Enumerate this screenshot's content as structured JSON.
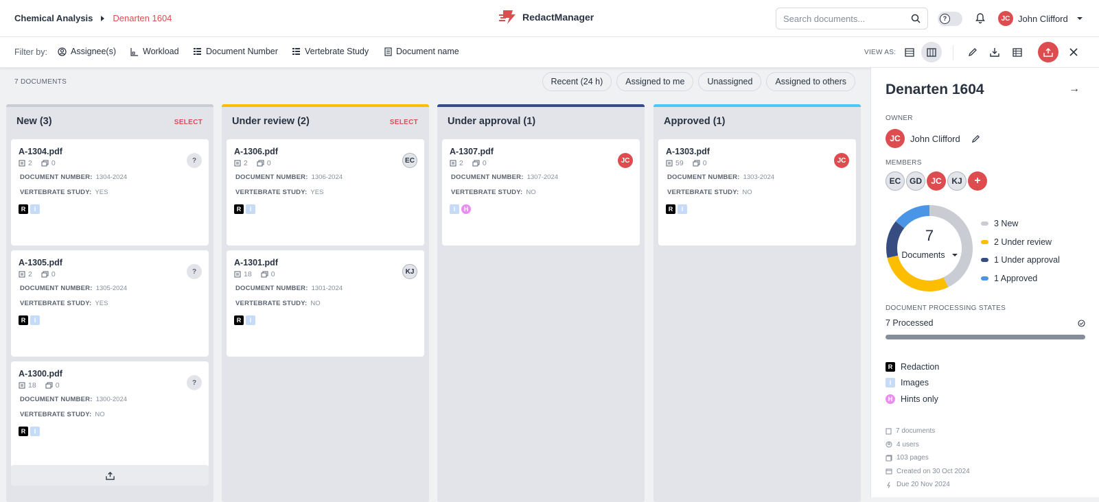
{
  "breadcrumb": {
    "parent": "Chemical Analysis",
    "current": "Denarten 1604"
  },
  "app": {
    "name": "RedactManager"
  },
  "search": {
    "placeholder": "Search documents..."
  },
  "user": {
    "initials": "JC",
    "name": "John Clifford"
  },
  "filters": {
    "label": "Filter by:",
    "items": [
      "Assignee(s)",
      "Workload",
      "Document Number",
      "Vertebrate Study",
      "Document name"
    ]
  },
  "view_as": "VIEW AS:",
  "main": {
    "doc_count": "7 DOCUMENTS",
    "quick_filters": [
      "Recent (24 h)",
      "Assigned to me",
      "Unassigned",
      "Assigned to others"
    ]
  },
  "labels": {
    "doc_number": "DOCUMENT NUMBER:",
    "vertebrate": "VERTEBRATE STUDY:",
    "select": "SELECT"
  },
  "columns": [
    {
      "title": "New (3)",
      "color": "#c9ccd2",
      "select": true,
      "cards": [
        {
          "name": "A-1304.pdf",
          "pages": "2",
          "annotations": "0",
          "doc_number": "1304-2024",
          "vertebrate": "YES",
          "assignee": "?",
          "assignee_style": "q",
          "tags": [
            "R",
            "I"
          ]
        },
        {
          "name": "A-1305.pdf",
          "pages": "2",
          "annotations": "0",
          "doc_number": "1305-2024",
          "vertebrate": "YES",
          "assignee": "?",
          "assignee_style": "q",
          "tags": [
            "R",
            "I"
          ]
        },
        {
          "name": "A-1300.pdf",
          "pages": "18",
          "annotations": "0",
          "doc_number": "1300-2024",
          "vertebrate": "NO",
          "assignee": "?",
          "assignee_style": "q",
          "tags": [
            "R",
            "I"
          ]
        }
      ]
    },
    {
      "title": "Under review (2)",
      "color": "#fdbd00",
      "select": true,
      "cards": [
        {
          "name": "A-1306.pdf",
          "pages": "2",
          "annotations": "0",
          "doc_number": "1306-2024",
          "vertebrate": "YES",
          "assignee": "EC",
          "assignee_style": "gray",
          "tags": [
            "R",
            "I"
          ]
        },
        {
          "name": "A-1301.pdf",
          "pages": "18",
          "annotations": "0",
          "doc_number": "1301-2024",
          "vertebrate": "NO",
          "assignee": "KJ",
          "assignee_style": "gray",
          "tags": [
            "R",
            "I"
          ]
        }
      ]
    },
    {
      "title": "Under approval (1)",
      "color": "#374c81",
      "select": false,
      "cards": [
        {
          "name": "A-1307.pdf",
          "pages": "2",
          "annotations": "0",
          "doc_number": "1307-2024",
          "vertebrate": "NO",
          "assignee": "JC",
          "assignee_style": "red",
          "tags": [
            "I",
            "H"
          ]
        }
      ]
    },
    {
      "title": "Approved (1)",
      "color": "#48c9f7",
      "select": false,
      "cards": [
        {
          "name": "A-1303.pdf",
          "pages": "59",
          "annotations": "0",
          "doc_number": "1303-2024",
          "vertebrate": "NO",
          "assignee": "JC",
          "assignee_style": "red",
          "tags": [
            "R",
            "I"
          ]
        }
      ]
    }
  ],
  "panel": {
    "title": "Denarten 1604",
    "owner_label": "OWNER",
    "owner": {
      "initials": "JC",
      "name": "John Clifford"
    },
    "members_label": "MEMBERS",
    "members": [
      "EC",
      "GD",
      "JC",
      "KJ"
    ],
    "chart": {
      "total": "7",
      "label": "Documents"
    },
    "legend": [
      {
        "text": "3 New",
        "color": "#c9ccd2"
      },
      {
        "text": "2 Under review",
        "color": "#fdbd00"
      },
      {
        "text": "1 Under approval",
        "color": "#374c81"
      },
      {
        "text": "1 Approved",
        "color": "#4a95e6"
      }
    ],
    "states_label": "DOCUMENT PROCESSING STATES",
    "processed": "7 Processed",
    "processed_fraction": 1.0,
    "types": [
      {
        "tag": "R",
        "label": "Redaction"
      },
      {
        "tag": "I",
        "label": "Images"
      },
      {
        "tag": "H",
        "label": "Hints only"
      }
    ],
    "stats": [
      "7 documents",
      "4 users",
      "103 pages",
      "Created on 30 Oct 2024",
      "Due 20 Nov 2024"
    ]
  },
  "chart_data": {
    "type": "pie",
    "categories": [
      "New",
      "Under review",
      "Under approval",
      "Approved"
    ],
    "values": [
      3,
      2,
      1,
      1
    ],
    "colors": [
      "#c9ccd2",
      "#fdbd00",
      "#374c81",
      "#4a95e6"
    ],
    "title": ""
  }
}
